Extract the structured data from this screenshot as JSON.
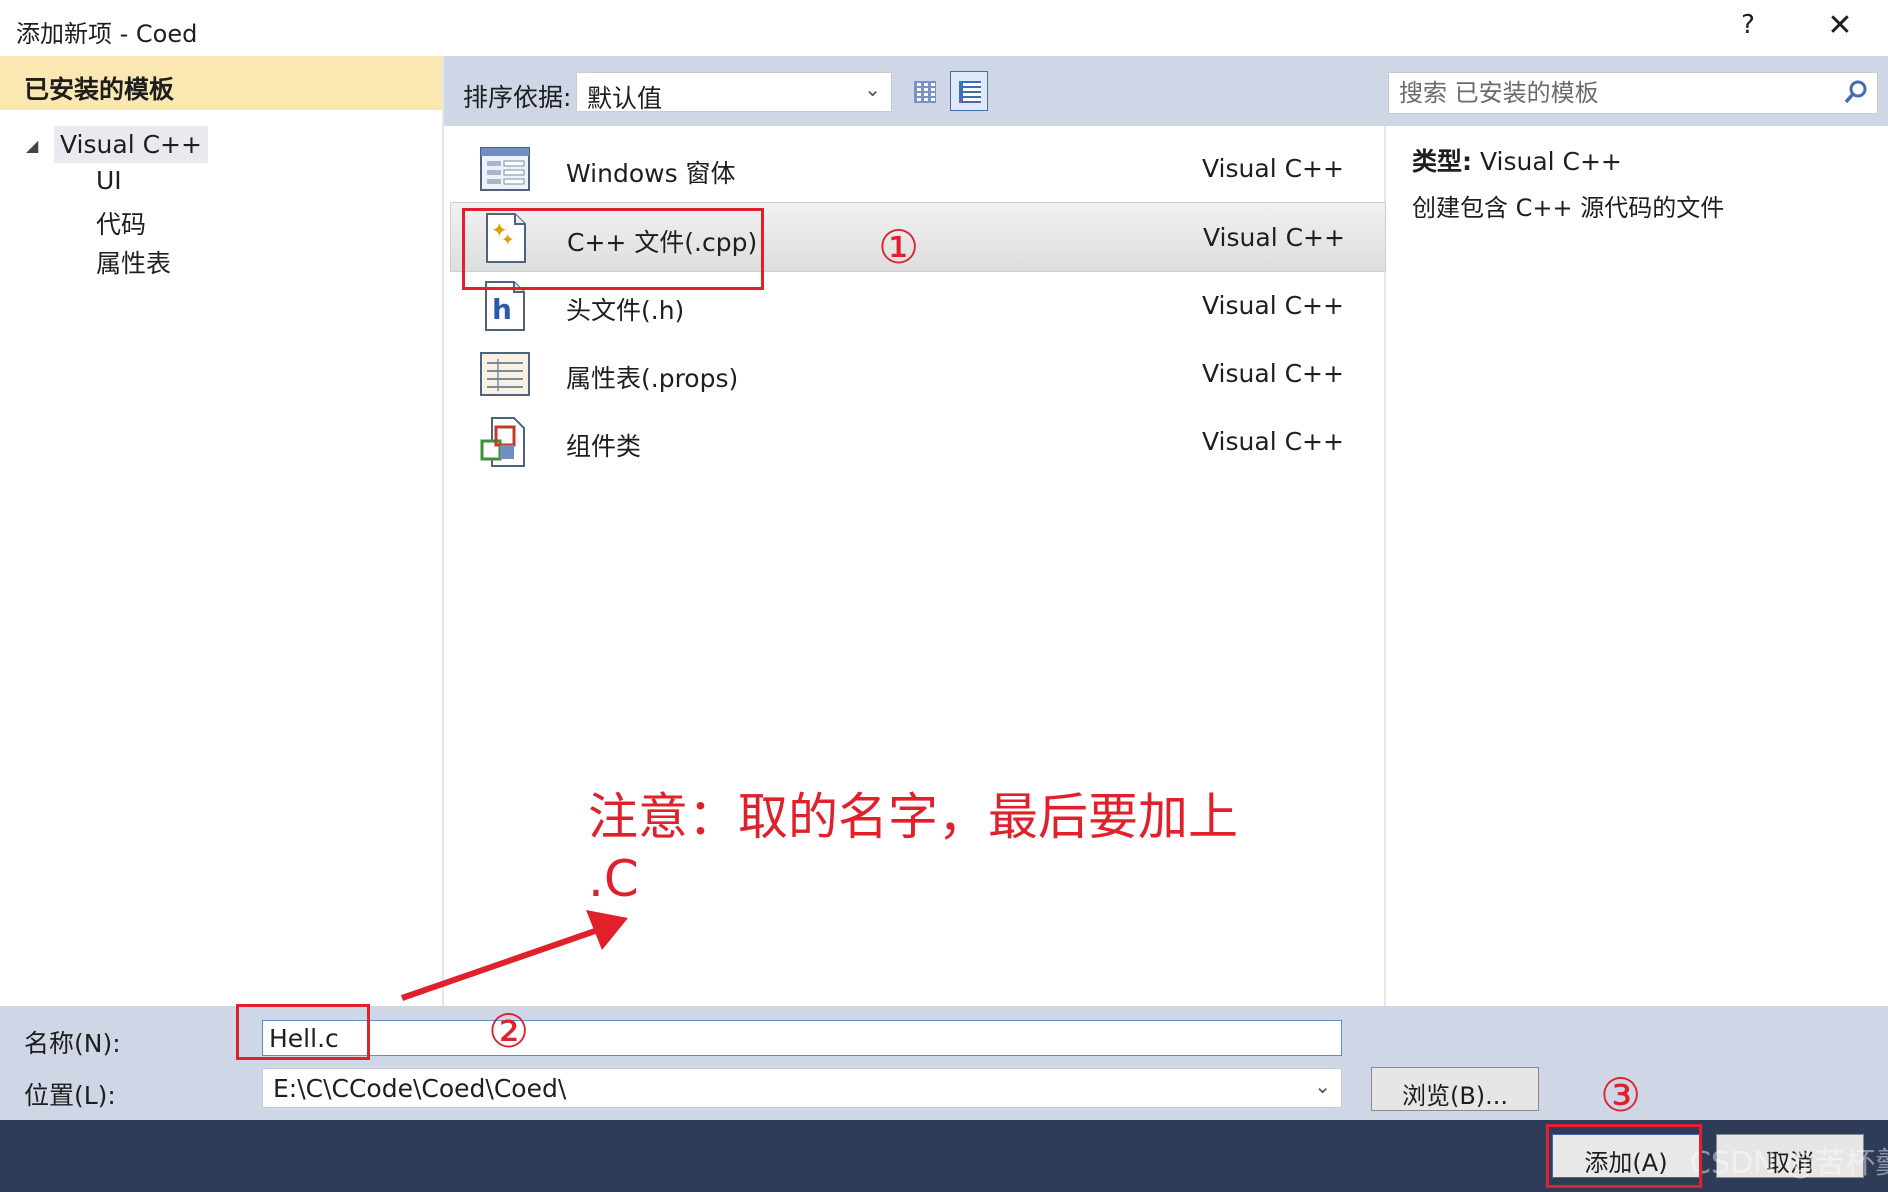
{
  "window": {
    "title": "添加新项 - Coed",
    "help": "?",
    "close": "✕"
  },
  "left": {
    "header": "已安装的模板",
    "tree": {
      "root": "Visual C++",
      "children": [
        "UI",
        "代码",
        "属性表"
      ]
    }
  },
  "toolbar": {
    "sort_label": "排序依据:",
    "sort_value": "默认值",
    "search_placeholder": "搜索 已安装的模板"
  },
  "templates": [
    {
      "name": "Windows 窗体",
      "lang": "Visual C++",
      "icon": "form-icon"
    },
    {
      "name": "C++ 文件(.cpp)",
      "lang": "Visual C++",
      "icon": "cpp-file-icon",
      "selected": true
    },
    {
      "name": "头文件(.h)",
      "lang": "Visual C++",
      "icon": "header-file-icon"
    },
    {
      "name": "属性表(.props)",
      "lang": "Visual C++",
      "icon": "property-sheet-icon"
    },
    {
      "name": "组件类",
      "lang": "Visual C++",
      "icon": "component-class-icon"
    }
  ],
  "details": {
    "type_label": "类型:",
    "type_value": "Visual C++",
    "description": "创建包含 C++ 源代码的文件"
  },
  "form": {
    "name_label": "名称(N):",
    "name_value": "Hell.c",
    "location_label": "位置(L):",
    "location_value": "E:\\C\\CCode\\Coed\\Coed\\",
    "browse": "浏览(B)...",
    "add": "添加(A)",
    "cancel": "取消"
  },
  "annotations": {
    "n1": "①",
    "n2": "②",
    "n3": "③",
    "note_line1": "注意：取的名字，最后要加上",
    "note_line2": ".C",
    "color": "#e0202a"
  },
  "watermark": "CSDN @苦杯羹"
}
